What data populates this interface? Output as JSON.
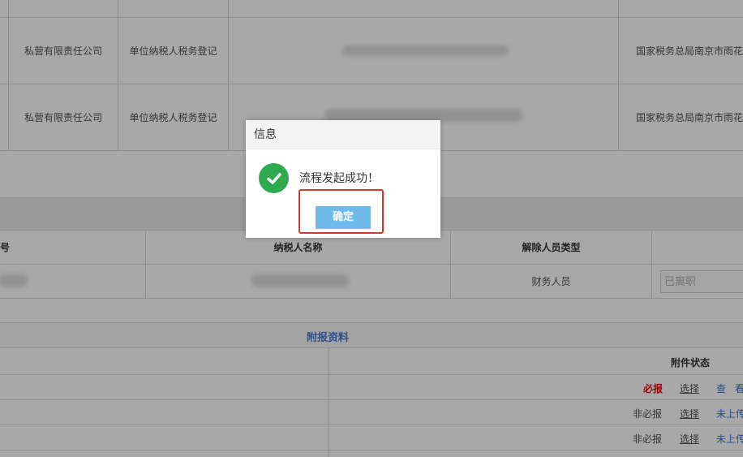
{
  "top_table": {
    "rows": [
      {
        "company_type": "私营有限责任公司",
        "reg_type": "单位纳税人税务登记",
        "authority": "国家税务总局南京市雨花"
      },
      {
        "company_type": "私营有限责任公司",
        "reg_type": "单位纳税人税务登记",
        "authority": "国家税务总局南京市雨花"
      }
    ]
  },
  "person_table": {
    "headers": {
      "col0": "号",
      "name": "纳税人名称",
      "type": "解除人员类型"
    },
    "row": {
      "type": "财务人员",
      "status_placeholder": "已离职"
    }
  },
  "attachments": {
    "title": "附报资料",
    "status_header": "附件状态",
    "rows": [
      {
        "required": "必报",
        "select": "选择",
        "action1": "查",
        "action2": "看"
      },
      {
        "required": "非必报",
        "select": "选择",
        "action1": "未上传"
      },
      {
        "required": "非必报",
        "select": "选择",
        "action1": "未上传"
      }
    ]
  },
  "dialog": {
    "title": "信息",
    "message": "流程发起成功！",
    "ok_label": "确定"
  }
}
